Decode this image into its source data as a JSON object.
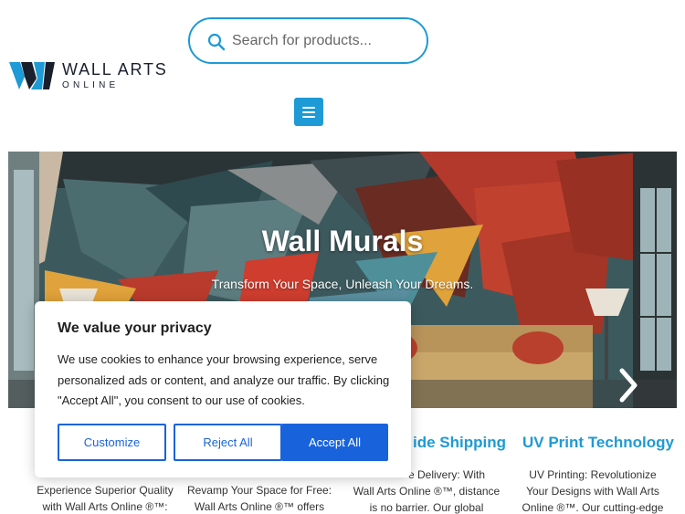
{
  "header": {
    "search_placeholder": "Search for products...",
    "logo_line1": "WALL ARTS",
    "logo_line2": "ONLINE"
  },
  "hero": {
    "title": "Wall Murals",
    "subtitle": "Transform Your Space, Unleash Your Dreams."
  },
  "features": [
    {
      "title": "",
      "text": [
        "Experience Superior Quality",
        "with Wall Arts Online ®™:"
      ]
    },
    {
      "title": "",
      "text": [
        "Revamp Your Space for Free:",
        "Wall Arts Online ®™ offers"
      ]
    },
    {
      "title": "ide Shipping",
      "text": [
        "e Delivery: With",
        "Wall Arts Online ®™, distance",
        "is no barrier. Our global"
      ]
    },
    {
      "title": "UV Print Technology",
      "text": [
        "UV Printing: Revolutionize",
        "Your Designs with Wall Arts",
        "Online ®™. Our cutting-edge"
      ]
    }
  ],
  "cookie": {
    "title": "We value your privacy",
    "body": "We use cookies to enhance your browsing experience, serve personalized ads or content, and analyze our traffic. By clicking \"Accept All\", you consent to our use of cookies.",
    "customize": "Customize",
    "reject": "Reject All",
    "accept": "Accept All"
  },
  "colors": {
    "accent": "#1e9ad6",
    "cookie_button": "#1863dc"
  }
}
